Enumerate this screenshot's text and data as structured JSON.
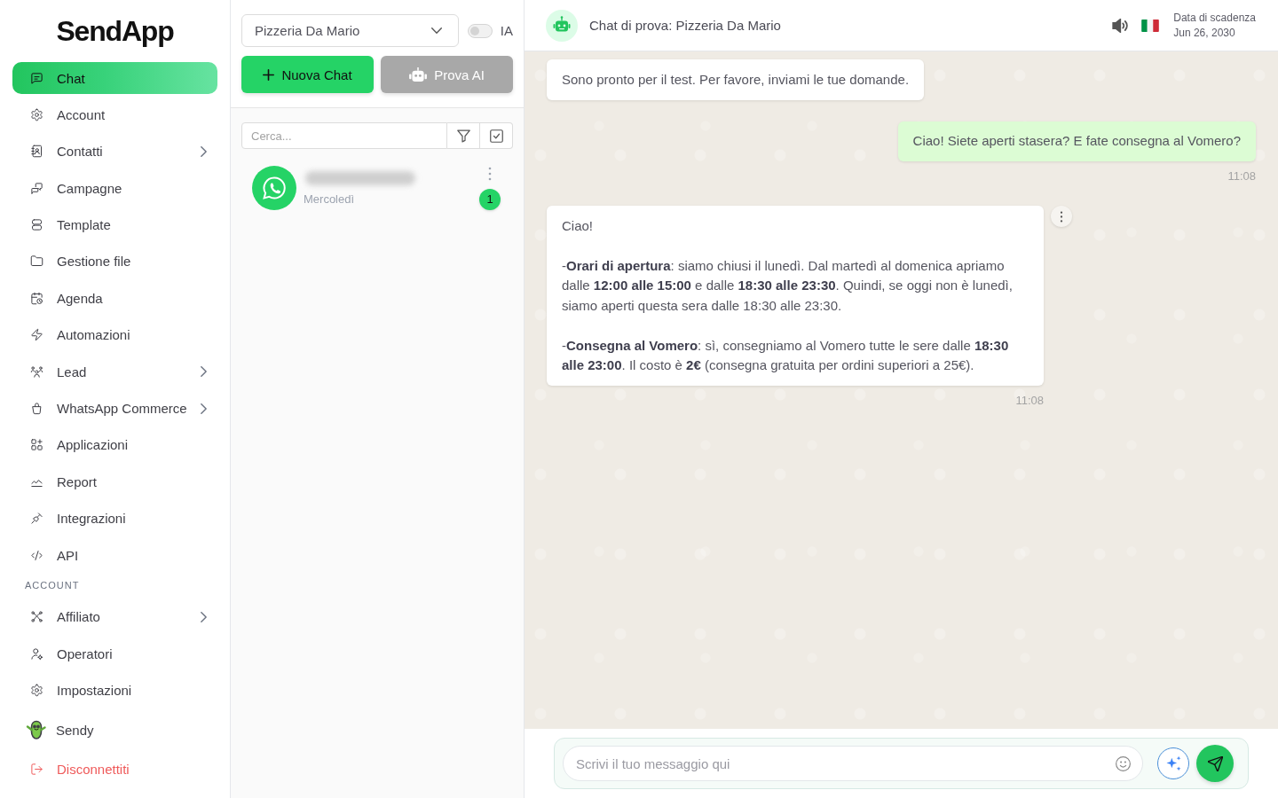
{
  "sidebar": {
    "logo": "SendApp",
    "sections": [
      {
        "items": [
          {
            "label": "Chat",
            "kind": "link",
            "selected": true,
            "has_submenu": false
          },
          {
            "label": "Account",
            "kind": "link",
            "selected": false,
            "has_submenu": false
          },
          {
            "label": "Contatti",
            "kind": "link",
            "selected": false,
            "has_submenu": true
          },
          {
            "label": "Campagne",
            "kind": "link",
            "selected": false,
            "has_submenu": false
          },
          {
            "label": "Template",
            "kind": "link",
            "selected": false,
            "has_submenu": false
          },
          {
            "label": "Gestione file",
            "kind": "link",
            "selected": false,
            "has_submenu": false
          },
          {
            "label": "Agenda",
            "kind": "link",
            "selected": false,
            "has_submenu": false
          },
          {
            "label": "Automazioni",
            "kind": "link",
            "selected": false,
            "has_submenu": false
          },
          {
            "label": "Lead",
            "kind": "link",
            "selected": false,
            "has_submenu": true
          },
          {
            "label": "WhatsApp Commerce",
            "kind": "link",
            "selected": false,
            "has_submenu": true
          },
          {
            "label": "Applicazioni",
            "kind": "link",
            "selected": false,
            "has_submenu": false
          },
          {
            "label": "Report",
            "kind": "link",
            "selected": false,
            "has_submenu": false
          },
          {
            "label": "Integrazioni",
            "kind": "link",
            "selected": false,
            "has_submenu": false
          },
          {
            "label": "API",
            "kind": "link",
            "selected": false,
            "has_submenu": false
          }
        ]
      },
      {
        "title": "ACCOUNT",
        "items": [
          {
            "label": "Affiliato",
            "kind": "link",
            "selected": false,
            "has_submenu": true
          },
          {
            "label": "Operatori",
            "kind": "link",
            "selected": false,
            "has_submenu": false
          },
          {
            "label": "Impostazioni",
            "kind": "link",
            "selected": false,
            "has_submenu": false
          },
          {
            "label": "Sendy",
            "kind": "mascot",
            "selected": false,
            "has_submenu": false
          },
          {
            "label": "Disconnettiti",
            "kind": "logout",
            "selected": false,
            "has_submenu": false
          }
        ]
      }
    ]
  },
  "chat_list_panel": {
    "business_select": {
      "value": "Pizzeria Da Mario"
    },
    "ai_toggle": {
      "label": "IA",
      "on": false
    },
    "buttons": [
      {
        "label": "Nuova Chat",
        "kind": "new-chat",
        "disabled": false
      },
      {
        "label": "Prova AI",
        "kind": "try-ai",
        "disabled": true
      }
    ],
    "search": {
      "placeholder": "Cerca..."
    },
    "chats": [
      {
        "time": "Mercoledì",
        "unread": "1",
        "selected": false
      }
    ]
  },
  "chat": {
    "header": {
      "title": "Chat di prova: Pizzeria Da Mario",
      "expiry_label": "Data di scadenza",
      "expiry_date": "Jun 26, 2030"
    },
    "messages": [
      {
        "kind": "incoming",
        "paragraphs": [
          "Sono pronto per il test. Per favore, inviami le tue domande."
        ],
        "menu_button": false
      },
      {
        "kind": "outgoing",
        "paragraphs": [
          "Ciao! Siete aperti stasera? E fate consegna al Vomero?"
        ],
        "time": "11:08",
        "menu_button": false
      },
      {
        "kind": "incoming",
        "paragraphs": [
          "Ciao!",
          "-**Orari di apertura**: siamo chiusi il lunedì. Dal martedì al domenica apriamo dalle **12:00 alle 15:00** e dalle **18:30 alle 23:30**. Quindi, se oggi non è lunedì, siamo aperti questa sera dalle 18:30 alle 23:30.",
          "-**Consegna al Vomero**: sì, consegniamo al Vomero tutte le sere dalle **18:30 alle 23:00**. Il costo è **2€** (consegna gratuita per ordini superiori a 25€)."
        ],
        "time": "11:08",
        "menu_button": true
      }
    ],
    "composer": {
      "placeholder": "Scrivi il tuo messaggio qui"
    }
  }
}
